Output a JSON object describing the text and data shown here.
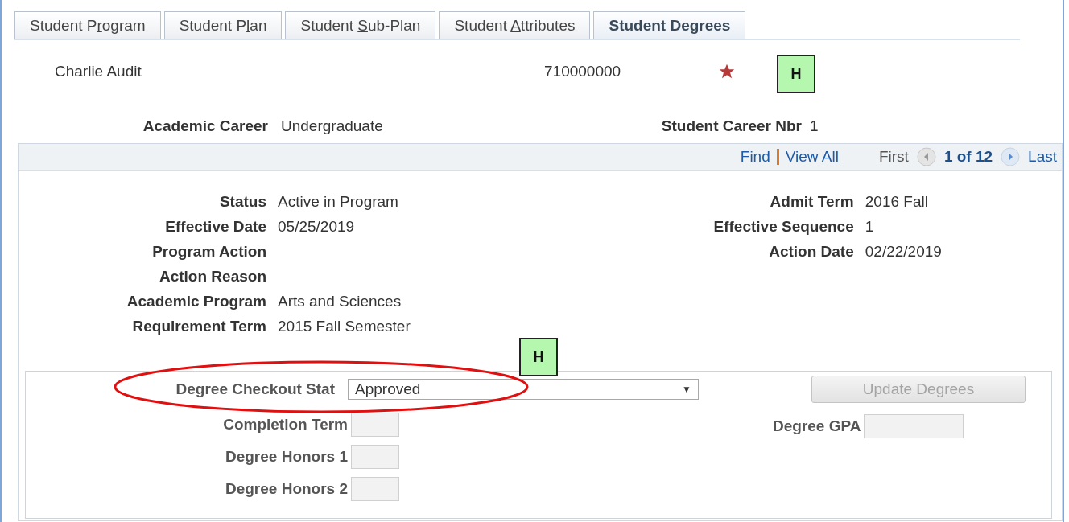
{
  "tabs": [
    {
      "before": "Student P",
      "key": "r",
      "after": "ogram",
      "selected": false
    },
    {
      "before": "Student P",
      "key": "l",
      "after": "an",
      "selected": false
    },
    {
      "before": "Student ",
      "key": "S",
      "after": "ub-Plan",
      "selected": false
    },
    {
      "before": "Student ",
      "key": "A",
      "after": "ttributes",
      "selected": false
    },
    {
      "before": "Student Degrees",
      "selected": true
    }
  ],
  "student": {
    "name": "Charlie Audit",
    "id": "710000000"
  },
  "career": {
    "label": "Academic Career",
    "value": "Undergraduate",
    "nbr_label": "Student Career Nbr",
    "nbr_value": "1"
  },
  "nav": {
    "find": "Find",
    "view_all": "View All",
    "first": "First",
    "position": "1 of 12",
    "last": "Last"
  },
  "left_fields": [
    {
      "label": "Status",
      "value": "Active in Program"
    },
    {
      "label": "Effective Date",
      "value": "05/25/2019"
    },
    {
      "label": "Program Action"
    },
    {
      "label": "Action Reason"
    },
    {
      "label": "Academic Program",
      "value": "Arts and Sciences"
    },
    {
      "label": "Requirement Term",
      "value": "2015 Fall Semester"
    }
  ],
  "right_fields": [
    {
      "label": "Admit Term",
      "value": "2016 Fall"
    },
    {
      "label": "Effective Sequence",
      "value": "1"
    },
    {
      "label": "Action Date",
      "value": "02/22/2019"
    }
  ],
  "degree": {
    "checkout_label": "Degree Checkout Stat",
    "checkout_value": "Approved",
    "dropdown_arrow": "▼",
    "update_button": {
      "label": "Update Degrees",
      "disabled": true
    },
    "inputs": [
      {
        "label": "Completion Term"
      },
      {
        "label": "Degree Honors 1"
      },
      {
        "label": "Degree Honors 2"
      }
    ],
    "gpa_label": "Degree GPA"
  },
  "annotations": [
    {
      "label": "H"
    },
    {
      "label": "H"
    }
  ]
}
